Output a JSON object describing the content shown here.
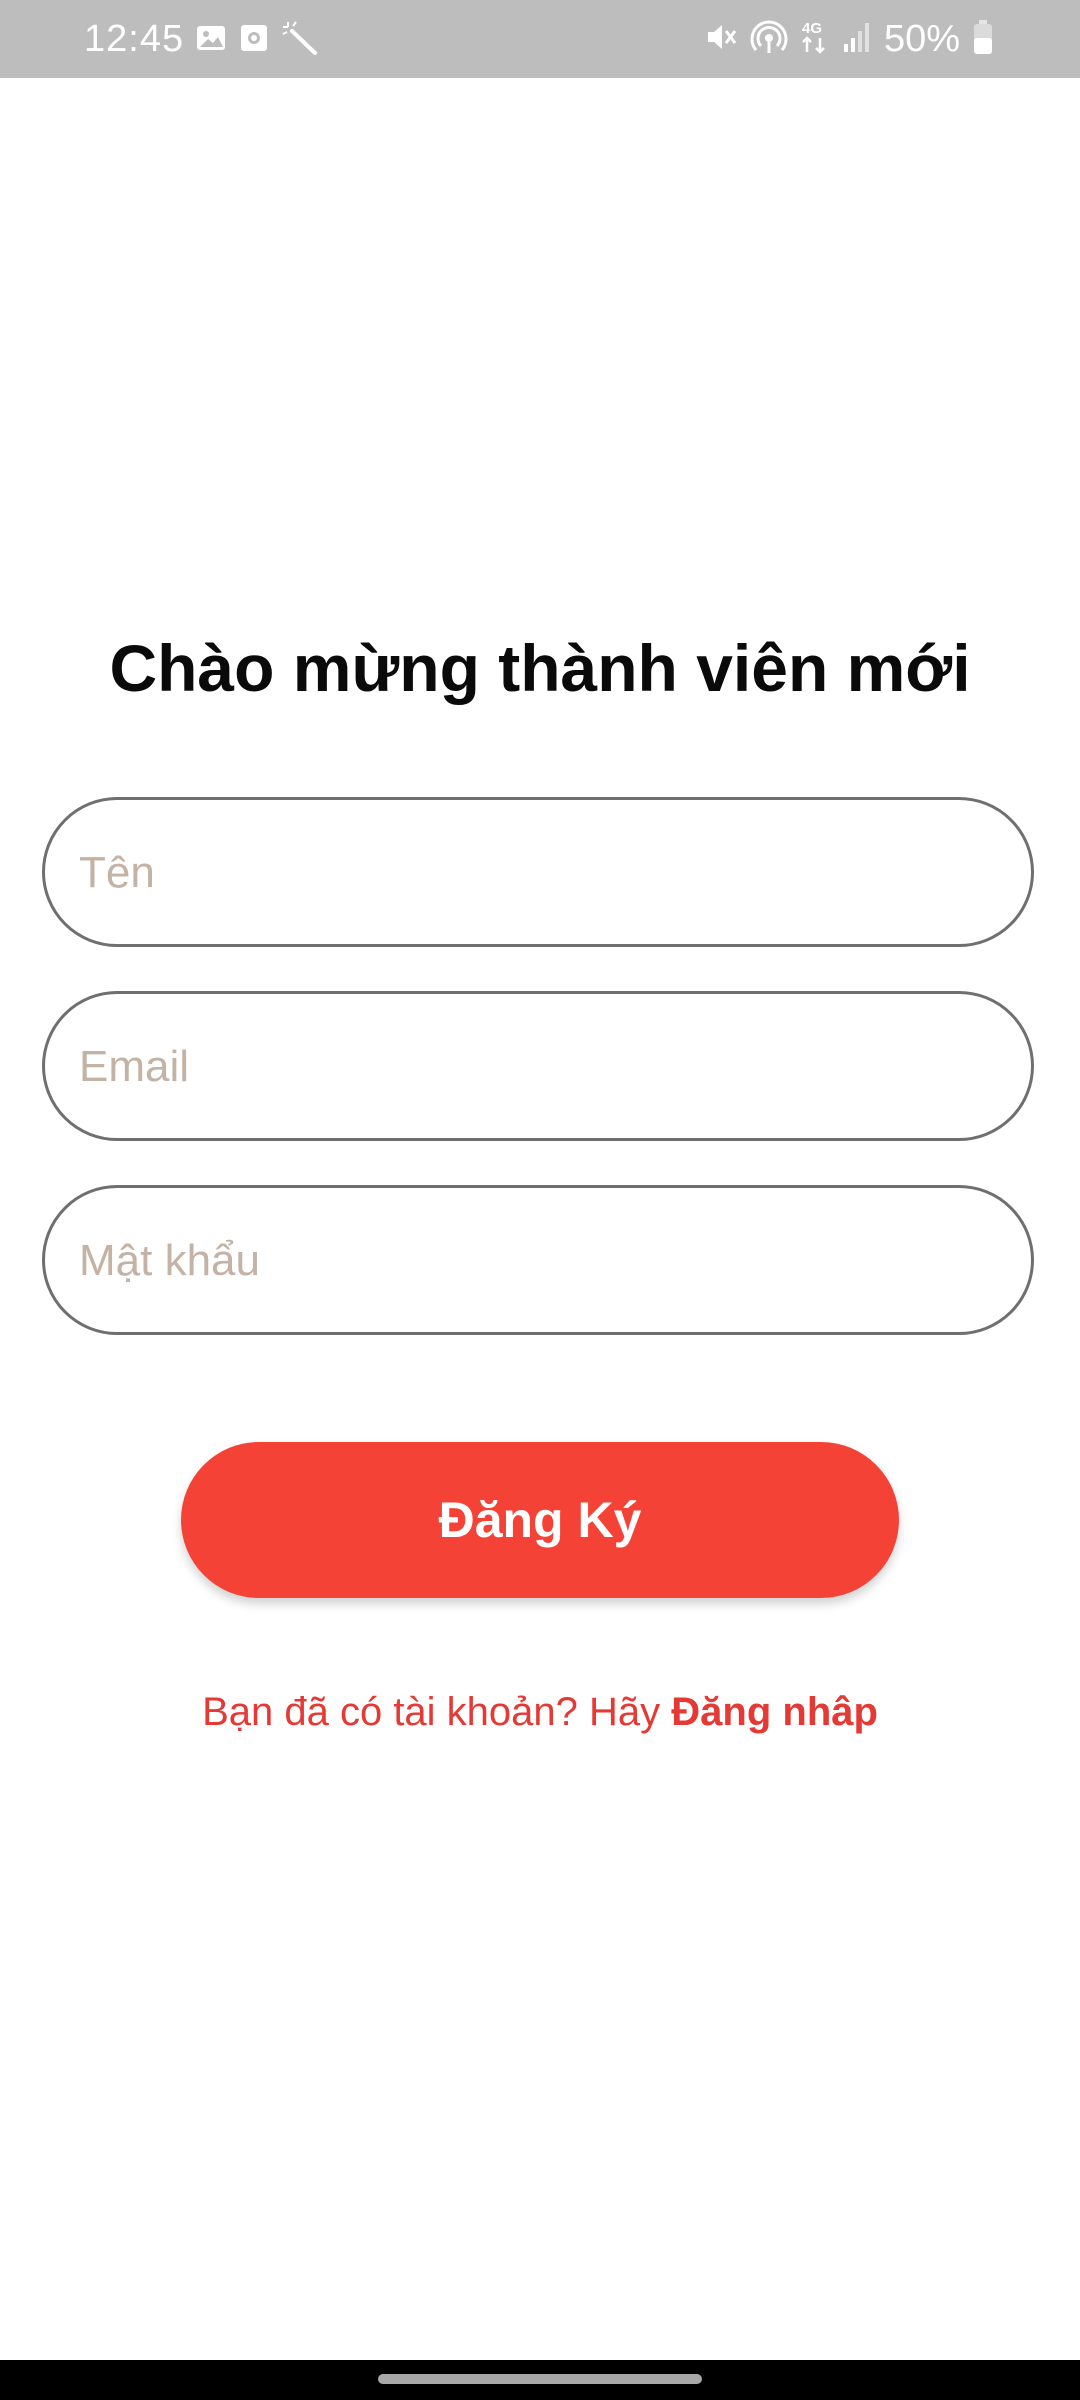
{
  "status_bar": {
    "time": "12:45",
    "battery_percent": "50%",
    "network": "4G",
    "left_icons": [
      "image-icon",
      "screen-record-icon",
      "magic-wand-icon"
    ],
    "right_icons": [
      "mute-icon",
      "hotspot-icon",
      "4g-data-icon",
      "signal-icon",
      "battery-icon"
    ]
  },
  "signup": {
    "title": "Chào mừng thành viên mới",
    "name_placeholder": "Tên",
    "email_placeholder": "Email",
    "password_placeholder": "Mật khẩu",
    "register_label": "Đăng Ký",
    "login_prompt": "Bạn đã có tài khoản? Hãy ",
    "login_link": "Đăng nhâp"
  },
  "colors": {
    "accent": "#f44336",
    "placeholder": "#c4b2a4",
    "status_bar": "#bdbdbd"
  }
}
